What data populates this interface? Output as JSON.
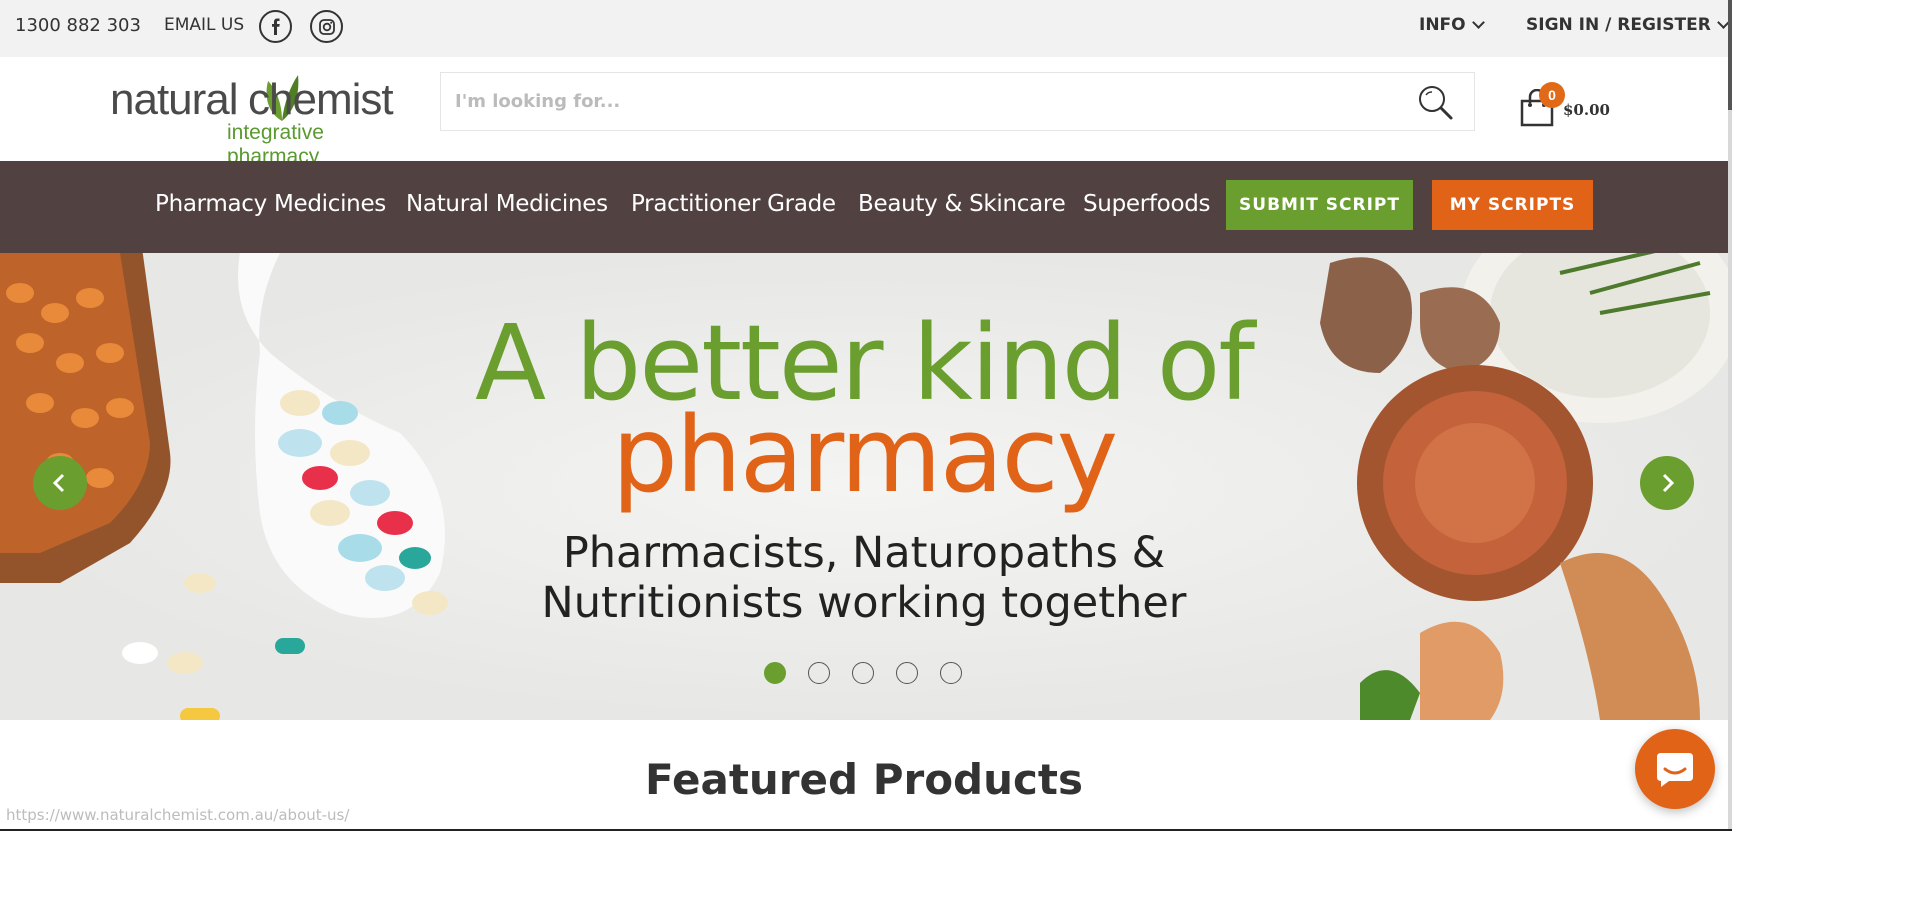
{
  "topbar": {
    "phone": "1300 882 303",
    "email_label": "EMAIL US",
    "social": [
      "facebook-icon",
      "instagram-icon"
    ],
    "info_label": "INFO",
    "signin_label": "SIGN IN / REGISTER"
  },
  "header": {
    "logo_word1": "natural",
    "logo_word2": "chemist",
    "logo_tagline": "integrative pharmacy",
    "search_placeholder": "I'm looking for...",
    "cart_count": "0",
    "cart_total": "$0.00"
  },
  "nav": {
    "items": [
      {
        "label": "Pharmacy Medicines"
      },
      {
        "label": "Natural Medicines"
      },
      {
        "label": "Practitioner Grade"
      },
      {
        "label": "Beauty & Skincare"
      },
      {
        "label": "Superfoods"
      }
    ],
    "submit_script": "SUBMIT SCRIPT",
    "my_scripts": "MY SCRIPTS"
  },
  "hero": {
    "headline_1": "A better kind of",
    "headline_2": "pharmacy",
    "subline_1": "Pharmacists, Naturopaths &",
    "subline_2": "Nutritionists working together",
    "slide_count": 5,
    "active_slide": 1
  },
  "featured_title": "Featured Products",
  "status_url": "https://www.naturalchemist.com.au/about-us/",
  "colors": {
    "brand_green": "#6a9e2e",
    "brand_orange": "#e06317",
    "nav_bg": "#514141",
    "topbar_bg": "#f2f2f2"
  }
}
